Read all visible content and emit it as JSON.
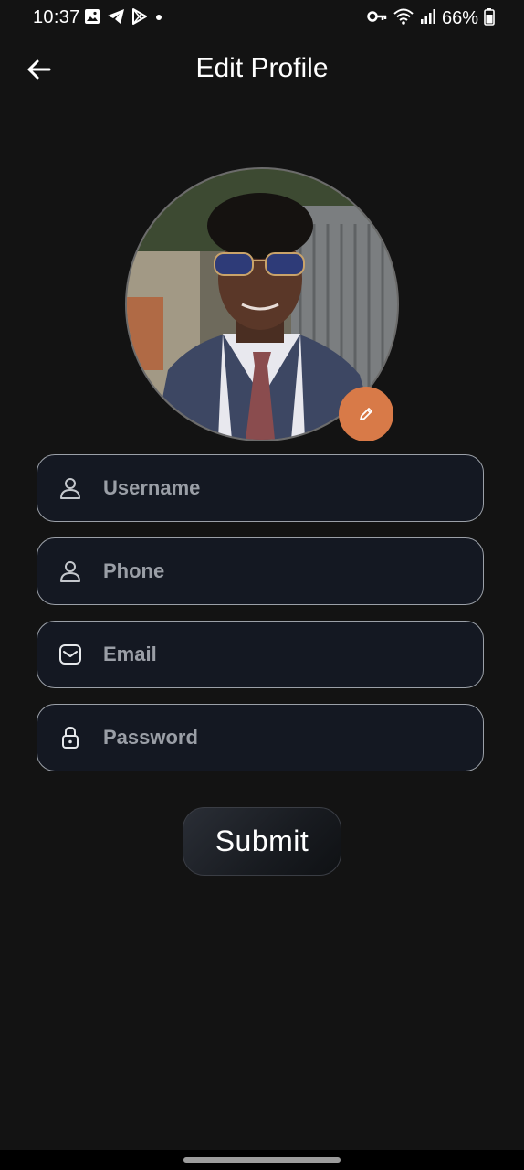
{
  "status_bar": {
    "time": "10:37",
    "battery": "66%",
    "left_icons": [
      "gallery-icon",
      "telegram-icon",
      "play-store-icon",
      "dot-icon"
    ],
    "right_icons": [
      "vpn-key-icon",
      "wifi-icon",
      "signal-icon",
      "battery-icon"
    ]
  },
  "header": {
    "title": "Edit Profile",
    "back_icon": "arrow-left-icon"
  },
  "avatar": {
    "edit_icon": "pencil-icon",
    "edit_color": "#d87a48"
  },
  "form": {
    "fields": [
      {
        "placeholder": "Username",
        "value": "",
        "icon": "person-icon"
      },
      {
        "placeholder": "Phone",
        "value": "",
        "icon": "person-icon"
      },
      {
        "placeholder": "Email",
        "value": "",
        "icon": "mail-icon"
      },
      {
        "placeholder": "Password",
        "value": "",
        "icon": "lock-icon"
      }
    ],
    "submit_label": "Submit"
  },
  "colors": {
    "background": "#131313",
    "field_background": "#141822",
    "field_border": "#9ba0a8",
    "accent": "#d87a48"
  }
}
